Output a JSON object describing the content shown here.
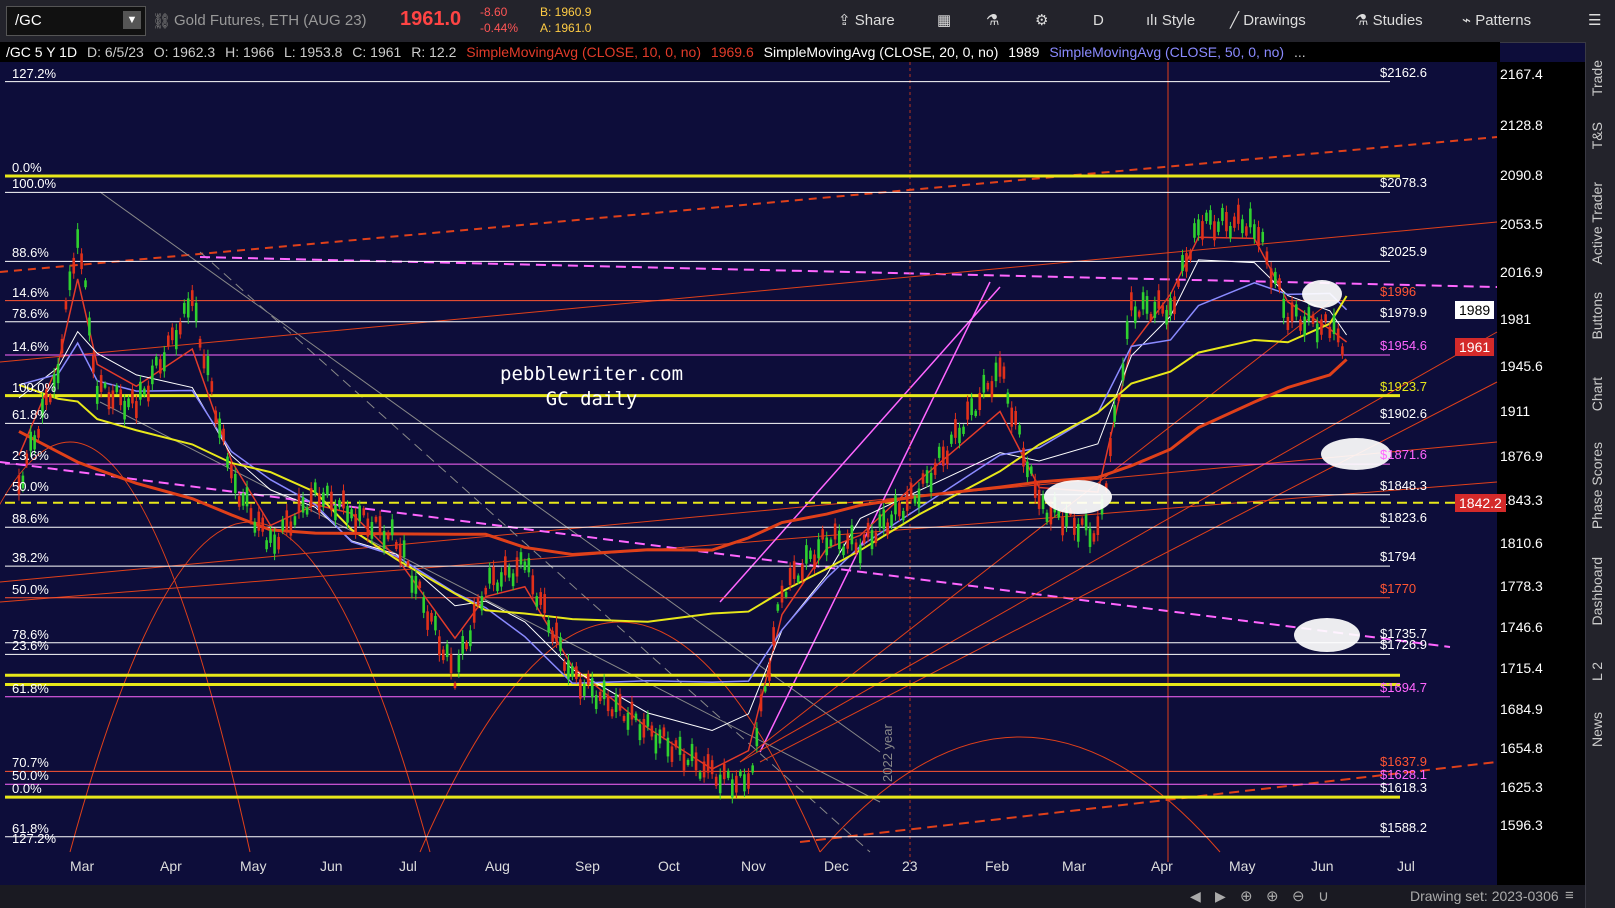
{
  "toolbar": {
    "symbol": "/GC",
    "instrument": "Gold Futures, ETH (AUG 23)",
    "last": "1961.0",
    "change": "-8.60",
    "change_pct": "-0.44%",
    "bid": "B: 1960.9",
    "ask": "A: 1961.0",
    "share": "Share",
    "period": "D",
    "style": "Style",
    "drawings": "Drawings",
    "studies": "Studies",
    "patterns": "Patterns"
  },
  "status": {
    "title": "/GC 5 Y 1D",
    "date": "D: 6/5/23",
    "open": "O: 1962.3",
    "high": "H: 1966",
    "low": "L: 1953.8",
    "close": "C: 1961",
    "range": "R: 12.2",
    "sma10": "SimpleMovingAvg (CLOSE, 10, 0, no)",
    "sma10_val": "1969.6",
    "sma20": "SimpleMovingAvg (CLOSE, 20, 0, no)",
    "sma20_val": "1989",
    "sma50": "SimpleMovingAvg (CLOSE, 50, 0, no)",
    "more": "..."
  },
  "side_tabs": [
    "Trade",
    "T&S",
    "Active Trader",
    "Buttons",
    "Chart",
    "Phase Scores",
    "Dashboard",
    "L 2",
    "News"
  ],
  "footer": {
    "drawing_set": "Drawing set: 2023-0306"
  },
  "watermark": {
    "line1": "pebblewriter.com",
    "line2": "GC daily"
  },
  "colors": {
    "bg": "#0d0d3a",
    "sma10": "#e23b2a",
    "sma20": "#ffffff",
    "sma50": "#8a8aff",
    "sma100": "#e8e81a",
    "sma200": "#e0401a"
  },
  "chart_data": {
    "type": "line",
    "title": "/GC 5 Y 1D",
    "ylim": [
      1572,
      2176
    ],
    "y_ticks": [
      2167.4,
      2128.8,
      2090.8,
      2053.5,
      2016.9,
      1981,
      1945.6,
      1911,
      1876.9,
      1843.3,
      1810.6,
      1778.3,
      1746.6,
      1715.4,
      1684.9,
      1654.8,
      1625.3,
      1596.3
    ],
    "x_ticks": [
      "Mar",
      "Apr",
      "May",
      "Jun",
      "Jul",
      "Aug",
      "Sep",
      "Oct",
      "Nov",
      "Dec",
      "23",
      "Feb",
      "Mar",
      "Apr",
      "May",
      "Jun",
      "Jul"
    ],
    "current_price": 1961,
    "price_tags": [
      "1989",
      "1961",
      "1842.2"
    ],
    "vertical_annotation": "2022 year",
    "close_series": {
      "x": [
        "2022-02-15",
        "2022-03-01",
        "2022-03-08",
        "2022-03-15",
        "2022-03-29",
        "2022-04-18",
        "2022-05-02",
        "2022-05-16",
        "2022-06-01",
        "2022-06-14",
        "2022-06-30",
        "2022-07-21",
        "2022-08-01",
        "2022-08-15",
        "2022-09-01",
        "2022-09-28",
        "2022-10-21",
        "2022-11-03",
        "2022-11-15",
        "2022-12-01",
        "2022-12-13",
        "2023-01-03",
        "2023-02-01",
        "2023-02-15",
        "2023-03-08",
        "2023-03-20",
        "2023-04-03",
        "2023-04-13",
        "2023-05-03",
        "2023-05-15",
        "2023-05-30",
        "2023-06-05"
      ],
      "y": [
        1856,
        1945,
        2050,
        1930,
        1915,
        1995,
        1860,
        1810,
        1850,
        1835,
        1815,
        1710,
        1780,
        1795,
        1710,
        1670,
        1635,
        1628,
        1775,
        1815,
        1810,
        1850,
        1945,
        1840,
        1818,
        1990,
        1990,
        2055,
        2055,
        1985,
        1975,
        1961
      ]
    },
    "levels": [
      {
        "label": "$2162.6",
        "value": 2162.6,
        "color": "#ffffff"
      },
      {
        "label": "$2078.3",
        "value": 2078.3,
        "color": "#ffffff"
      },
      {
        "label": "$2025.9",
        "value": 2025.9,
        "color": "#ffffff"
      },
      {
        "label": "$1996",
        "value": 1996,
        "color": "#ff5533"
      },
      {
        "label": "$1979.9",
        "value": 1979.9,
        "color": "#ffffff"
      },
      {
        "label": "$1954.6",
        "value": 1954.6,
        "color": "#ff66ff"
      },
      {
        "label": "$1923.7",
        "value": 1923.7,
        "color": "#e8e81a"
      },
      {
        "label": "$1902.6",
        "value": 1902.6,
        "color": "#ffffff"
      },
      {
        "label": "$1871.6",
        "value": 1871.6,
        "color": "#ff66ff"
      },
      {
        "label": "$1848.3",
        "value": 1848.3,
        "color": "#ffffff"
      },
      {
        "label": "$1823.6",
        "value": 1823.6,
        "color": "#ffffff"
      },
      {
        "label": "$1794",
        "value": 1794,
        "color": "#ffffff"
      },
      {
        "label": "$1770",
        "value": 1770,
        "color": "#ff5533"
      },
      {
        "label": "$1735.7",
        "value": 1735.7,
        "color": "#ffffff"
      },
      {
        "label": "$1726.9",
        "value": 1726.9,
        "color": "#ffffff"
      },
      {
        "label": "$1694.7",
        "value": 1694.7,
        "color": "#ff66ff"
      },
      {
        "label": "$1637.9",
        "value": 1637.9,
        "color": "#ff5533"
      },
      {
        "label": "$1628.1",
        "value": 1628.1,
        "color": "#ff66ff"
      },
      {
        "label": "$1618.3",
        "value": 1618.3,
        "color": "#ffffff"
      },
      {
        "label": "$1588.2",
        "value": 1588.2,
        "color": "#ffffff"
      }
    ],
    "fib_labels": [
      {
        "label": "127.2%",
        "value": 2162.6
      },
      {
        "label": "0.0%",
        "value": 2090.8
      },
      {
        "label": "100.0%",
        "value": 2078.3
      },
      {
        "label": "88.6%",
        "value": 2025.9
      },
      {
        "label": "14.6%",
        "value": 1996
      },
      {
        "label": "78.6%",
        "value": 1979.9
      },
      {
        "label": "14.6%",
        "value": 1954.6
      },
      {
        "label": "100.0%",
        "value": 1923.7
      },
      {
        "label": "61.8%",
        "value": 1902.6
      },
      {
        "label": "23.6%",
        "value": 1871.6
      },
      {
        "label": "50.0%",
        "value": 1848.3
      },
      {
        "label": "88.6%",
        "value": 1823.6
      },
      {
        "label": "38.2%",
        "value": 1794
      },
      {
        "label": "50.0%",
        "value": 1770
      },
      {
        "label": "78.6%",
        "value": 1735.7
      },
      {
        "label": "23.6%",
        "value": 1726.9
      },
      {
        "label": "61.8%",
        "value": 1694.7
      },
      {
        "label": "70.7%",
        "value": 1637.9
      },
      {
        "label": "50.0%",
        "value": 1628.1
      },
      {
        "label": "0.0%",
        "value": 1618.3
      },
      {
        "label": "61.8%",
        "value": 1588.2
      },
      {
        "label": "127.2%",
        "value": 1580
      }
    ]
  }
}
